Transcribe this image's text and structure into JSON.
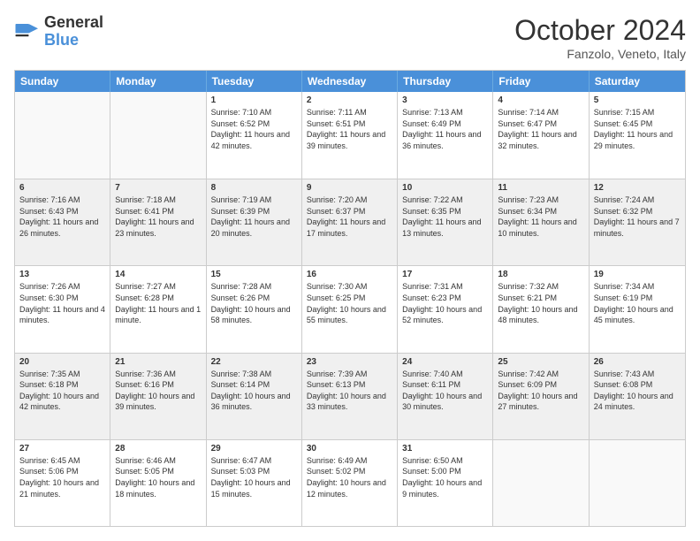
{
  "header": {
    "logo_line1": "General",
    "logo_line2": "Blue",
    "month_title": "October 2024",
    "location": "Fanzolo, Veneto, Italy"
  },
  "weekdays": [
    "Sunday",
    "Monday",
    "Tuesday",
    "Wednesday",
    "Thursday",
    "Friday",
    "Saturday"
  ],
  "rows": [
    [
      {
        "day": "",
        "sunrise": "",
        "sunset": "",
        "daylight": "",
        "empty": true
      },
      {
        "day": "",
        "sunrise": "",
        "sunset": "",
        "daylight": "",
        "empty": true
      },
      {
        "day": "1",
        "sunrise": "Sunrise: 7:10 AM",
        "sunset": "Sunset: 6:52 PM",
        "daylight": "Daylight: 11 hours and 42 minutes."
      },
      {
        "day": "2",
        "sunrise": "Sunrise: 7:11 AM",
        "sunset": "Sunset: 6:51 PM",
        "daylight": "Daylight: 11 hours and 39 minutes."
      },
      {
        "day": "3",
        "sunrise": "Sunrise: 7:13 AM",
        "sunset": "Sunset: 6:49 PM",
        "daylight": "Daylight: 11 hours and 36 minutes."
      },
      {
        "day": "4",
        "sunrise": "Sunrise: 7:14 AM",
        "sunset": "Sunset: 6:47 PM",
        "daylight": "Daylight: 11 hours and 32 minutes."
      },
      {
        "day": "5",
        "sunrise": "Sunrise: 7:15 AM",
        "sunset": "Sunset: 6:45 PM",
        "daylight": "Daylight: 11 hours and 29 minutes."
      }
    ],
    [
      {
        "day": "6",
        "sunrise": "Sunrise: 7:16 AM",
        "sunset": "Sunset: 6:43 PM",
        "daylight": "Daylight: 11 hours and 26 minutes."
      },
      {
        "day": "7",
        "sunrise": "Sunrise: 7:18 AM",
        "sunset": "Sunset: 6:41 PM",
        "daylight": "Daylight: 11 hours and 23 minutes."
      },
      {
        "day": "8",
        "sunrise": "Sunrise: 7:19 AM",
        "sunset": "Sunset: 6:39 PM",
        "daylight": "Daylight: 11 hours and 20 minutes."
      },
      {
        "day": "9",
        "sunrise": "Sunrise: 7:20 AM",
        "sunset": "Sunset: 6:37 PM",
        "daylight": "Daylight: 11 hours and 17 minutes."
      },
      {
        "day": "10",
        "sunrise": "Sunrise: 7:22 AM",
        "sunset": "Sunset: 6:35 PM",
        "daylight": "Daylight: 11 hours and 13 minutes."
      },
      {
        "day": "11",
        "sunrise": "Sunrise: 7:23 AM",
        "sunset": "Sunset: 6:34 PM",
        "daylight": "Daylight: 11 hours and 10 minutes."
      },
      {
        "day": "12",
        "sunrise": "Sunrise: 7:24 AM",
        "sunset": "Sunset: 6:32 PM",
        "daylight": "Daylight: 11 hours and 7 minutes."
      }
    ],
    [
      {
        "day": "13",
        "sunrise": "Sunrise: 7:26 AM",
        "sunset": "Sunset: 6:30 PM",
        "daylight": "Daylight: 11 hours and 4 minutes."
      },
      {
        "day": "14",
        "sunrise": "Sunrise: 7:27 AM",
        "sunset": "Sunset: 6:28 PM",
        "daylight": "Daylight: 11 hours and 1 minute."
      },
      {
        "day": "15",
        "sunrise": "Sunrise: 7:28 AM",
        "sunset": "Sunset: 6:26 PM",
        "daylight": "Daylight: 10 hours and 58 minutes."
      },
      {
        "day": "16",
        "sunrise": "Sunrise: 7:30 AM",
        "sunset": "Sunset: 6:25 PM",
        "daylight": "Daylight: 10 hours and 55 minutes."
      },
      {
        "day": "17",
        "sunrise": "Sunrise: 7:31 AM",
        "sunset": "Sunset: 6:23 PM",
        "daylight": "Daylight: 10 hours and 52 minutes."
      },
      {
        "day": "18",
        "sunrise": "Sunrise: 7:32 AM",
        "sunset": "Sunset: 6:21 PM",
        "daylight": "Daylight: 10 hours and 48 minutes."
      },
      {
        "day": "19",
        "sunrise": "Sunrise: 7:34 AM",
        "sunset": "Sunset: 6:19 PM",
        "daylight": "Daylight: 10 hours and 45 minutes."
      }
    ],
    [
      {
        "day": "20",
        "sunrise": "Sunrise: 7:35 AM",
        "sunset": "Sunset: 6:18 PM",
        "daylight": "Daylight: 10 hours and 42 minutes."
      },
      {
        "day": "21",
        "sunrise": "Sunrise: 7:36 AM",
        "sunset": "Sunset: 6:16 PM",
        "daylight": "Daylight: 10 hours and 39 minutes."
      },
      {
        "day": "22",
        "sunrise": "Sunrise: 7:38 AM",
        "sunset": "Sunset: 6:14 PM",
        "daylight": "Daylight: 10 hours and 36 minutes."
      },
      {
        "day": "23",
        "sunrise": "Sunrise: 7:39 AM",
        "sunset": "Sunset: 6:13 PM",
        "daylight": "Daylight: 10 hours and 33 minutes."
      },
      {
        "day": "24",
        "sunrise": "Sunrise: 7:40 AM",
        "sunset": "Sunset: 6:11 PM",
        "daylight": "Daylight: 10 hours and 30 minutes."
      },
      {
        "day": "25",
        "sunrise": "Sunrise: 7:42 AM",
        "sunset": "Sunset: 6:09 PM",
        "daylight": "Daylight: 10 hours and 27 minutes."
      },
      {
        "day": "26",
        "sunrise": "Sunrise: 7:43 AM",
        "sunset": "Sunset: 6:08 PM",
        "daylight": "Daylight: 10 hours and 24 minutes."
      }
    ],
    [
      {
        "day": "27",
        "sunrise": "Sunrise: 6:45 AM",
        "sunset": "Sunset: 5:06 PM",
        "daylight": "Daylight: 10 hours and 21 minutes."
      },
      {
        "day": "28",
        "sunrise": "Sunrise: 6:46 AM",
        "sunset": "Sunset: 5:05 PM",
        "daylight": "Daylight: 10 hours and 18 minutes."
      },
      {
        "day": "29",
        "sunrise": "Sunrise: 6:47 AM",
        "sunset": "Sunset: 5:03 PM",
        "daylight": "Daylight: 10 hours and 15 minutes."
      },
      {
        "day": "30",
        "sunrise": "Sunrise: 6:49 AM",
        "sunset": "Sunset: 5:02 PM",
        "daylight": "Daylight: 10 hours and 12 minutes."
      },
      {
        "day": "31",
        "sunrise": "Sunrise: 6:50 AM",
        "sunset": "Sunset: 5:00 PM",
        "daylight": "Daylight: 10 hours and 9 minutes."
      },
      {
        "day": "",
        "sunrise": "",
        "sunset": "",
        "daylight": "",
        "empty": true
      },
      {
        "day": "",
        "sunrise": "",
        "sunset": "",
        "daylight": "",
        "empty": true
      }
    ]
  ]
}
